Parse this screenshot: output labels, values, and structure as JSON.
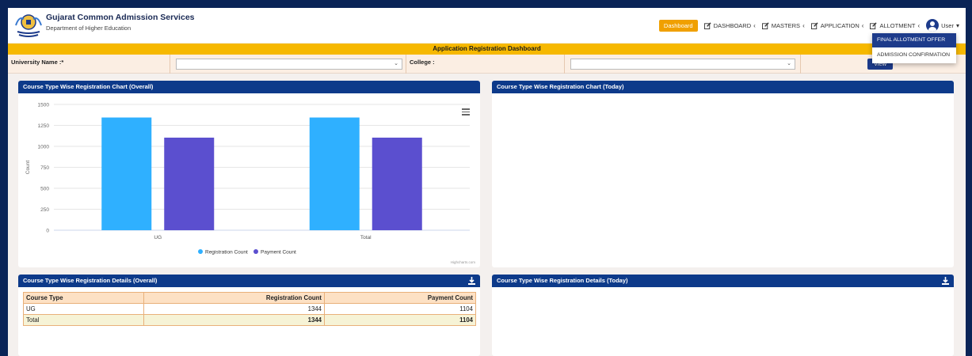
{
  "header": {
    "title": "Gujarat Common Admission Services",
    "subtitle": "Department of Higher Education"
  },
  "nav": {
    "dashboard_btn": "Dashboard",
    "items": [
      "DASHBOARD",
      "MASTERS",
      "APPLICATION",
      "ALLOTMENT"
    ],
    "user": "User"
  },
  "dropdown": {
    "items": [
      "FINAL ALLOTMENT OFFER",
      "ADMISSION CONFIRMATION"
    ]
  },
  "banner": "Application Registration Dashboard",
  "filters": {
    "university_label": "University Name :*",
    "college_label": "College :",
    "view_label": "View"
  },
  "panels": {
    "chart_overall": "Course Type Wise Registration Chart (Overall)",
    "chart_today": "Course Type Wise Registration Chart (Today)",
    "details_overall": "Course Type Wise Registration Details (Overall)",
    "details_today": "Course Type Wise Registration Details (Today)"
  },
  "chart_data": {
    "type": "bar",
    "categories": [
      "UG",
      "Total"
    ],
    "series": [
      {
        "name": "Registration Count",
        "values": [
          1344,
          1344
        ],
        "color": "#2fb0ff"
      },
      {
        "name": "Payment Count",
        "values": [
          1104,
          1104
        ],
        "color": "#5b4fcf"
      }
    ],
    "ylabel": "Count",
    "ylim": [
      0,
      1500
    ],
    "yticks": [
      0,
      250,
      500,
      750,
      1000,
      1250,
      1500
    ],
    "credit": "Highcharts.com",
    "legend_position": "bottom-center"
  },
  "table": {
    "headers": [
      "Course Type",
      "Registration Count",
      "Payment Count"
    ],
    "rows": [
      [
        "UG",
        "1344",
        "1104"
      ],
      [
        "Total",
        "1344",
        "1104"
      ]
    ]
  }
}
